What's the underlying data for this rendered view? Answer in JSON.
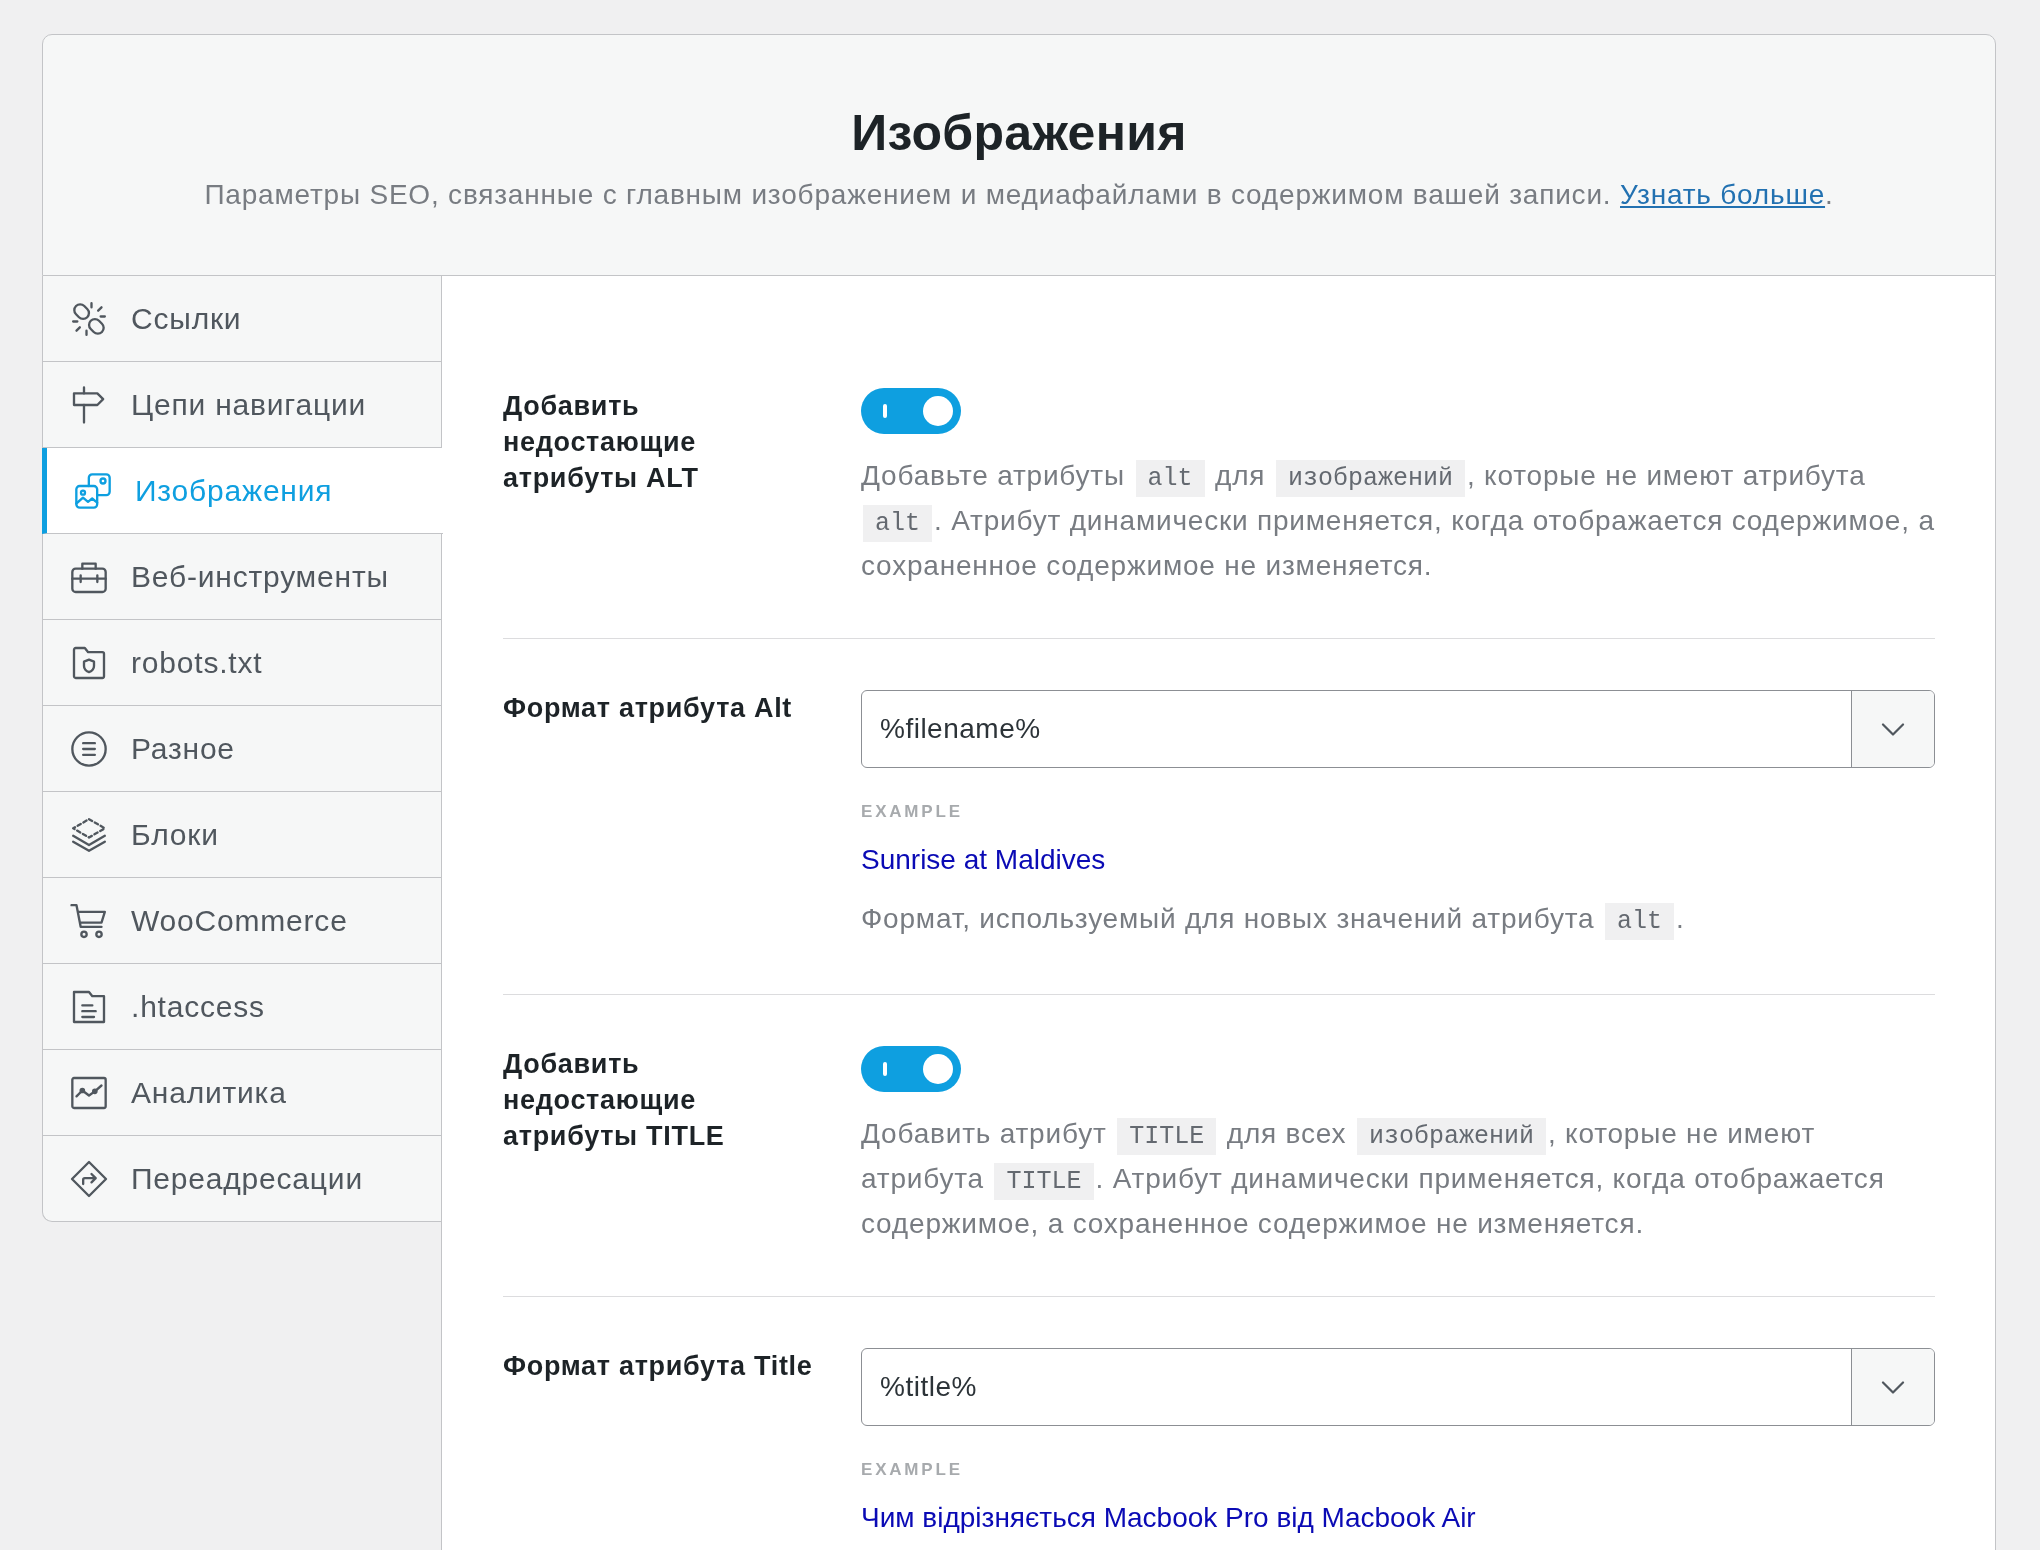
{
  "header": {
    "title": "Изображения",
    "description": "Параметры SEO, связанные с главным изображением и медиафайлами в содержимом вашей записи.",
    "link": "Узнать больше",
    "link_suffix": "."
  },
  "sidebar": {
    "items": [
      {
        "label": "Ссылки",
        "selected": false
      },
      {
        "label": "Цепи навигации",
        "selected": false
      },
      {
        "label": "Изображения",
        "selected": true
      },
      {
        "label": "Веб-инструменты",
        "selected": false
      },
      {
        "label": "robots.txt",
        "selected": false
      },
      {
        "label": "Разное",
        "selected": false
      },
      {
        "label": "Блоки",
        "selected": false
      },
      {
        "label": "WooCommerce",
        "selected": false
      },
      {
        "label": ".htaccess",
        "selected": false
      },
      {
        "label": "Аналитика",
        "selected": false
      },
      {
        "label": "Переадресации",
        "selected": false
      }
    ]
  },
  "settings": [
    {
      "kind": "toggle",
      "label": "Добавить недостающие атрибуты ALT",
      "on": true,
      "description": [
        {
          "kind": "text",
          "text": "Добавьте атрибуты "
        },
        {
          "kind": "code",
          "text": "alt"
        },
        {
          "kind": "text",
          "text": " для "
        },
        {
          "kind": "code",
          "text": "изображений"
        },
        {
          "kind": "text",
          "text": ", которые не имеют атрибута "
        },
        {
          "kind": "code",
          "text": "alt"
        },
        {
          "kind": "text",
          "text": ". Атрибут динамически применяется, когда отображается содержимое, а сохраненное содержимое не изменяется."
        }
      ]
    },
    {
      "kind": "select",
      "label": "Формат атрибута Alt",
      "value": "%filename%",
      "example_label": "EXAMPLE",
      "example": "Sunrise at Maldives",
      "description": [
        {
          "kind": "text",
          "text": "Формат, используемый для новых значений атрибута "
        },
        {
          "kind": "code",
          "text": "alt"
        },
        {
          "kind": "text",
          "text": "."
        }
      ]
    },
    {
      "kind": "toggle",
      "label": "Добавить недостающие атрибуты TITLE",
      "on": true,
      "description": [
        {
          "kind": "text",
          "text": "Добавить атрибут "
        },
        {
          "kind": "code",
          "text": "TITLE"
        },
        {
          "kind": "text",
          "text": " для всех "
        },
        {
          "kind": "code",
          "text": "изображений"
        },
        {
          "kind": "text",
          "text": ", которые не имеют атрибута "
        },
        {
          "kind": "code",
          "text": "TITLE"
        },
        {
          "kind": "text",
          "text": ". Атрибут динамически применяется, когда отображается содержимое, а сохраненное содержимое не изменяется."
        }
      ]
    },
    {
      "kind": "select",
      "label": "Формат атрибута Title",
      "value": "%title%",
      "example_label": "EXAMPLE",
      "example": "Чим відрізняється Macbook Pro від Macbook Air"
    }
  ]
}
